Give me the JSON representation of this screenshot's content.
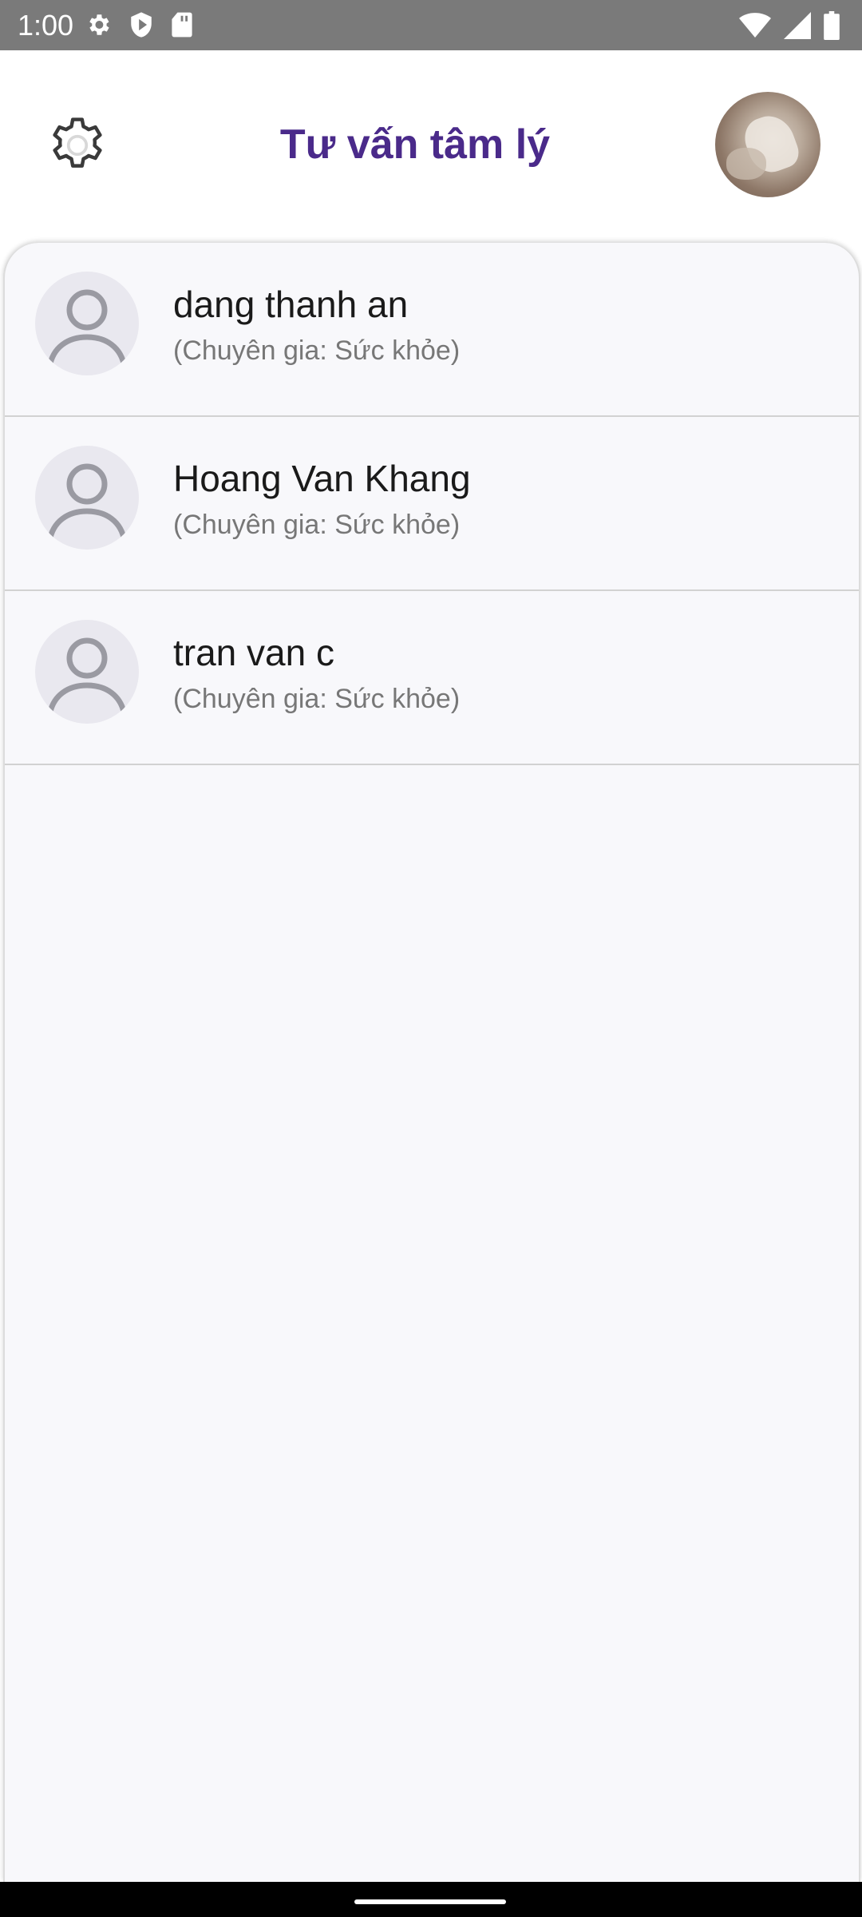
{
  "status_bar": {
    "time": "1:00",
    "left_icons": [
      "gear-icon",
      "shield-icon",
      "sd-card-icon"
    ],
    "right_icons": [
      "wifi-icon",
      "signal-icon",
      "battery-icon"
    ]
  },
  "header": {
    "title": "Tư vấn tâm lý",
    "title_color": "#4a2a8a",
    "settings_icon": "gear-icon",
    "profile_avatar": "user-photo"
  },
  "experts": [
    {
      "name": "dang thanh an",
      "role": "(Chuyên gia: Sức khỏe)"
    },
    {
      "name": "Hoang Van Khang",
      "role": "(Chuyên gia: Sức khỏe)"
    },
    {
      "name": "tran van c",
      "role": "(Chuyên gia: Sức khỏe)"
    }
  ],
  "colors": {
    "list_background": "#f8f8fb",
    "divider": "#d2d2d2",
    "placeholder_avatar": "#e9e8ef"
  }
}
